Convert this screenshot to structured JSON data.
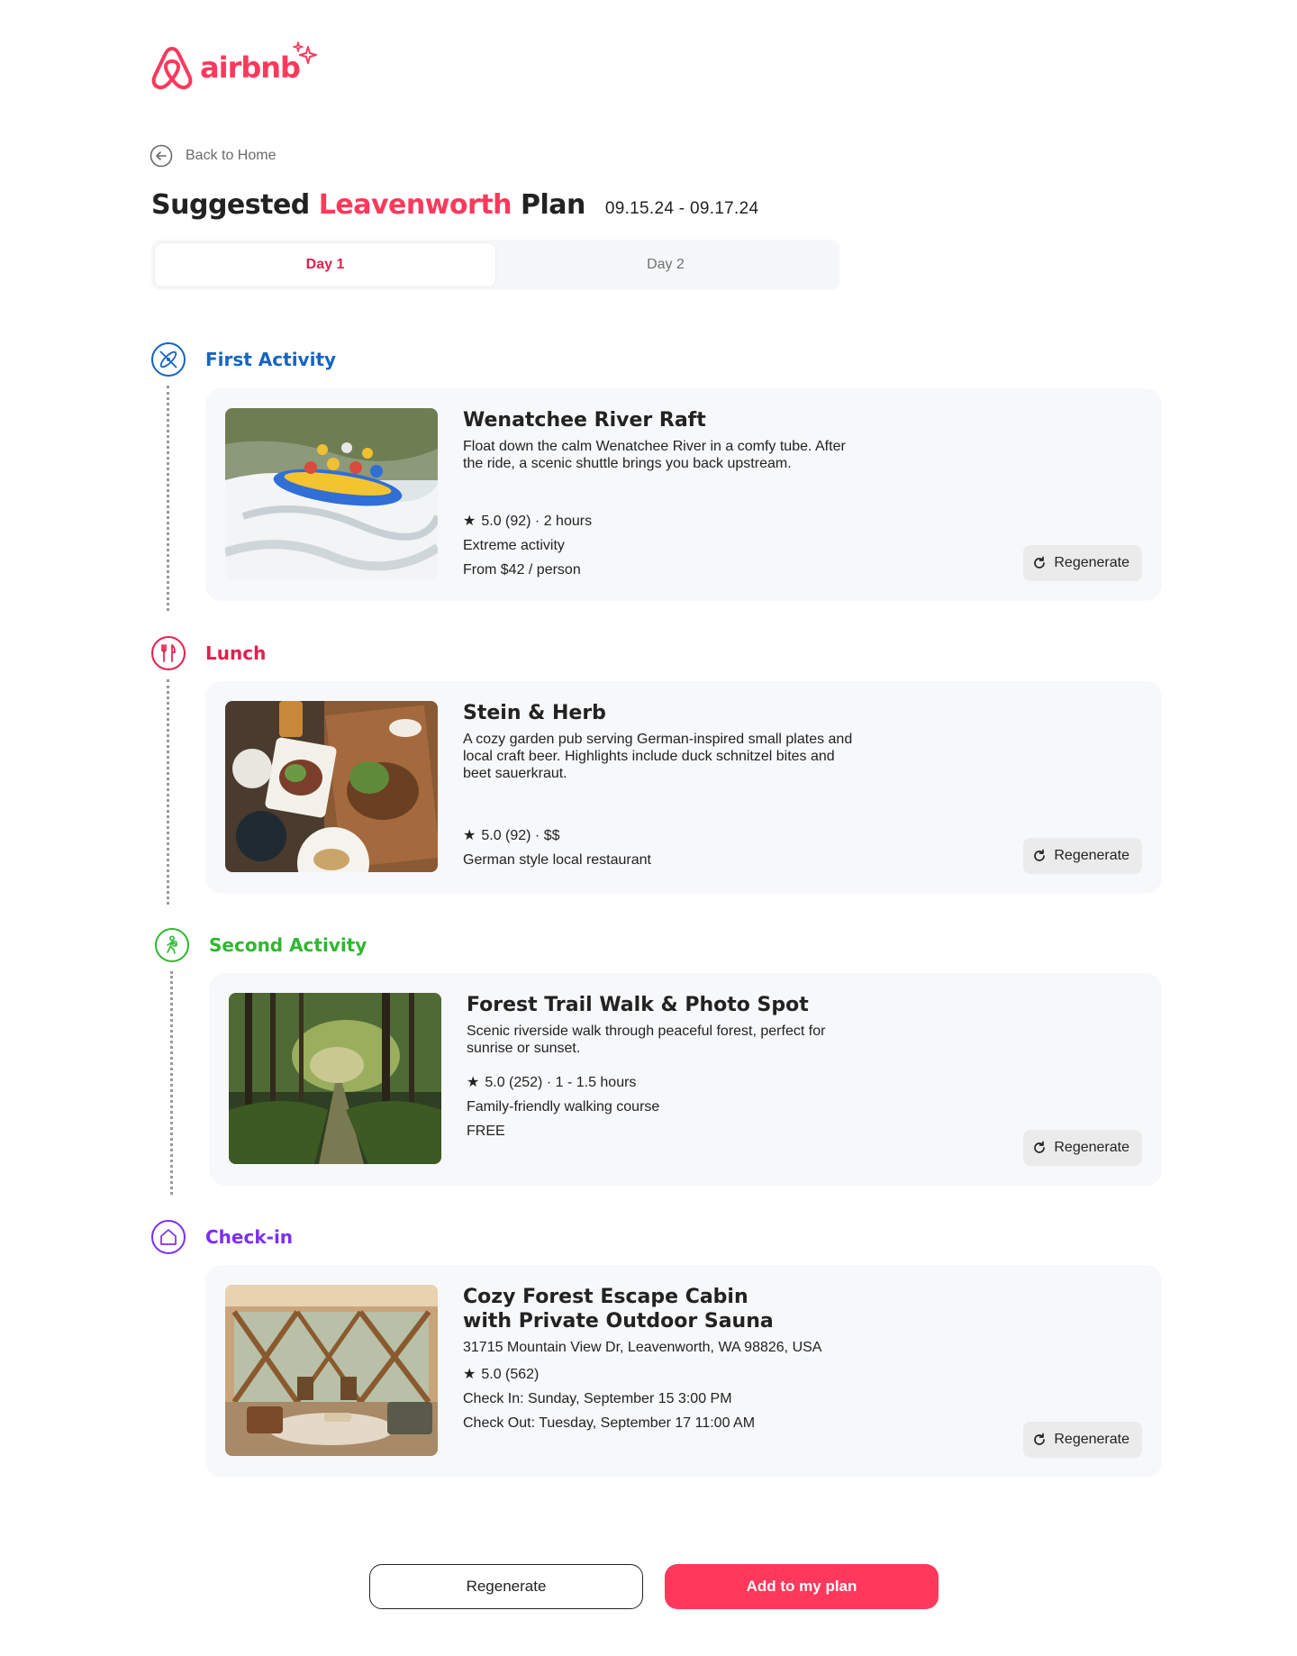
{
  "brand": {
    "name": "airbnb",
    "color": "#ff385c"
  },
  "nav": {
    "back_label": "Back to Home"
  },
  "header": {
    "title_prefix": "Suggested ",
    "title_city": "Leavenworth",
    "title_suffix": " Plan",
    "dates": "09.15.24 - 09.17.24"
  },
  "tabs": [
    {
      "label": "Day 1",
      "active": true
    },
    {
      "label": "Day 2",
      "active": false
    }
  ],
  "sections": [
    {
      "label": "First Activity",
      "color": "#1565c0",
      "icon": "kayak-icon",
      "card": {
        "title": "Wenatchee River Raft",
        "description": "Float down the calm Wenatchee River in a comfy tube. After the ride, a scenic shuttle brings you back upstream.",
        "rating": "5.0 (92) · 2 hours",
        "meta": [
          "Extreme activity",
          "From $42 / person"
        ],
        "regenerate_label": "Regenerate"
      }
    },
    {
      "label": "Lunch",
      "color": "#e61e4d",
      "icon": "utensils-icon",
      "card": {
        "title": "Stein & Herb",
        "description": "A cozy garden pub serving German-inspired small plates and local craft beer. Highlights include duck schnitzel bites and beet sauerkraut.",
        "rating": "5.0 (92) · $$",
        "meta": [
          "German style local restaurant"
        ],
        "regenerate_label": "Regenerate"
      }
    },
    {
      "label": "Second Activity",
      "color": "#2eb82e",
      "icon": "hiker-icon",
      "card": {
        "title": "Forest Trail Walk & Photo Spot",
        "description": "Scenic riverside walk through peaceful forest, perfect for sunrise or sunset.",
        "rating": "5.0 (252) · 1 - 1.5 hours",
        "meta": [
          "Family-friendly walking course",
          "FREE"
        ],
        "regenerate_label": "Regenerate"
      }
    },
    {
      "label": "Check-in",
      "color": "#7b2ff7",
      "icon": "home-icon",
      "card": {
        "title_line1": "Cozy Forest Escape Cabin",
        "title_line2": "with Private Outdoor Sauna",
        "description": "31715 Mountain View Dr, Leavenworth, WA 98826, USA",
        "rating": "5.0 (562)",
        "meta": [
          "Check In: Sunday, September 15 3:00 PM",
          "Check Out: Tuesday, September 17 11:00 AM"
        ],
        "regenerate_label": "Regenerate"
      }
    }
  ],
  "footer": {
    "regenerate_label": "Regenerate",
    "add_label": "Add to my plan"
  }
}
